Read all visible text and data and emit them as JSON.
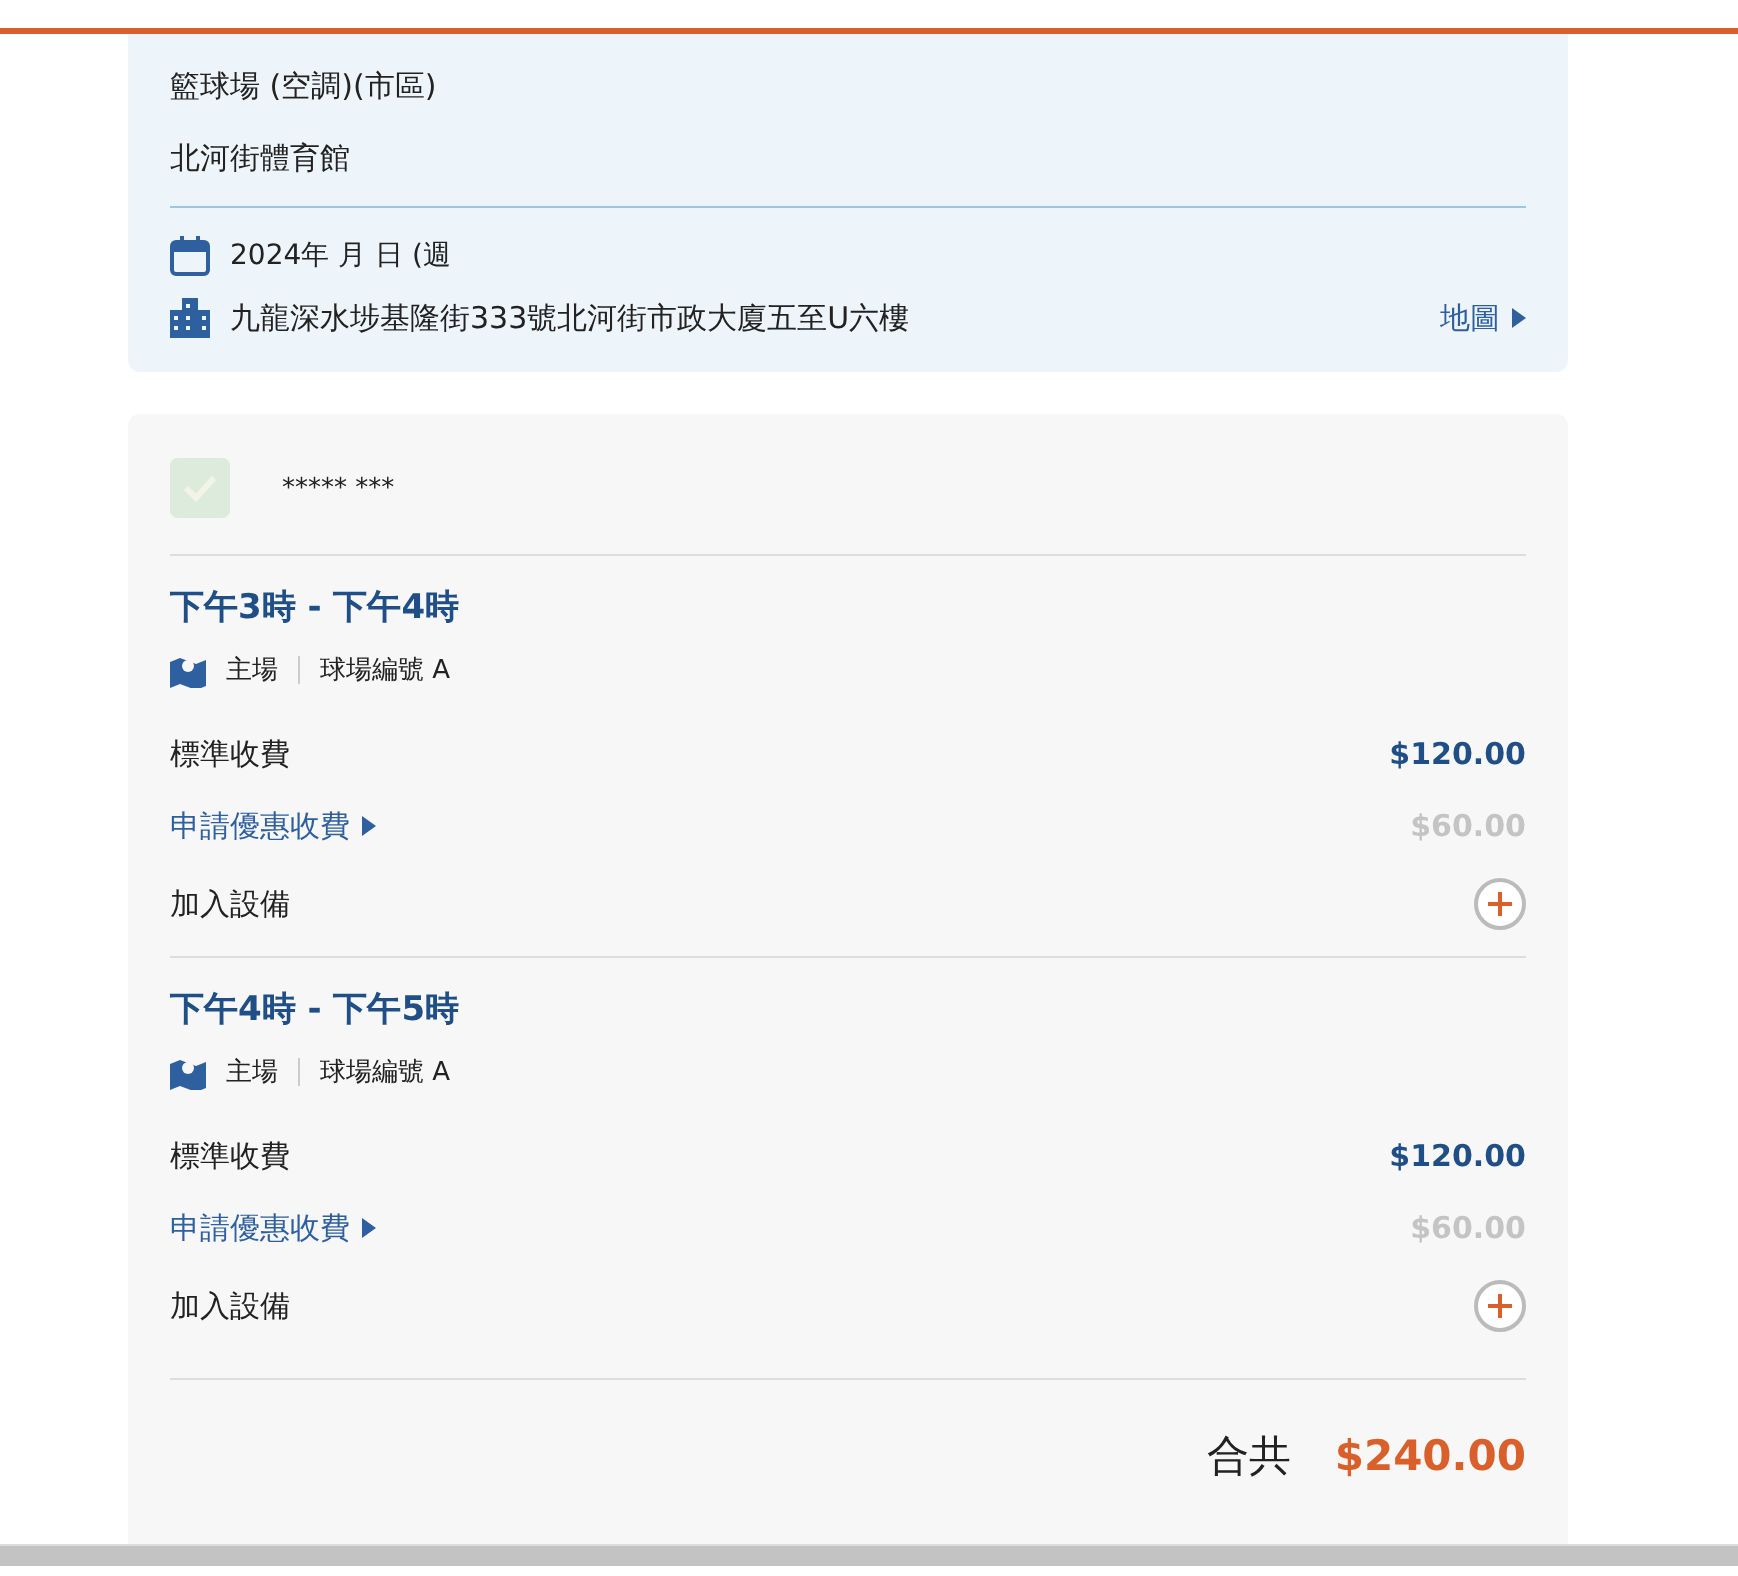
{
  "venue": {
    "facility": "籃球場 (空調)(市區)",
    "name": "北河街體育館",
    "date": "2024年 月 日 (週",
    "address": "九龍深水埗基隆街333號北河街市政大廈五至U六樓",
    "map_link": "地圖"
  },
  "booking": {
    "checked": true,
    "disabled": true,
    "holder": "***** ***",
    "slots": [
      {
        "time": "下午3時 - 下午4時",
        "area": "主場",
        "court": "球場編號 A",
        "standard_label": "標準收費",
        "standard_price": "$120.00",
        "discount_link": "申請優惠收費",
        "discount_price": "$60.00",
        "equipment_label": "加入設備"
      },
      {
        "time": "下午4時 - 下午5時",
        "area": "主場",
        "court": "球場編號 A",
        "standard_label": "標準收費",
        "standard_price": "$120.00",
        "discount_link": "申請優惠收費",
        "discount_price": "$60.00",
        "equipment_label": "加入設備"
      }
    ],
    "total_label": "合共",
    "total": "$240.00"
  }
}
